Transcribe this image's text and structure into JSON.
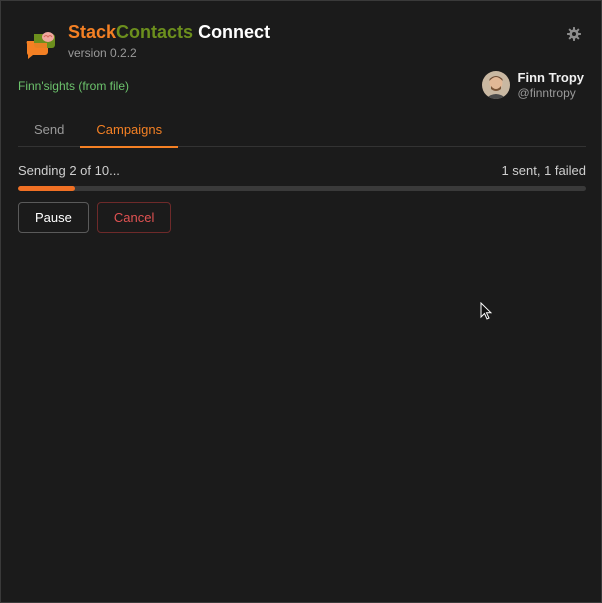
{
  "app": {
    "title_part1": "Stack",
    "title_part2": "Contacts",
    "title_part3": " Connect",
    "version": "version 0.2.2"
  },
  "source_label": "Finn'sights (from file)",
  "user": {
    "name": "Finn Tropy",
    "handle": "@finntropy"
  },
  "tabs": [
    {
      "label": "Send",
      "active": false
    },
    {
      "label": "Campaigns",
      "active": true
    }
  ],
  "campaign": {
    "status": "Sending 2 of 10...",
    "summary": "1 sent, 1 failed",
    "progress_fraction": 0.1
  },
  "buttons": {
    "pause": "Pause",
    "cancel": "Cancel"
  },
  "colors": {
    "accent": "#f48024",
    "brand_green": "#6c8f1d",
    "source_green": "#6cc36c",
    "danger": "#e05252"
  }
}
